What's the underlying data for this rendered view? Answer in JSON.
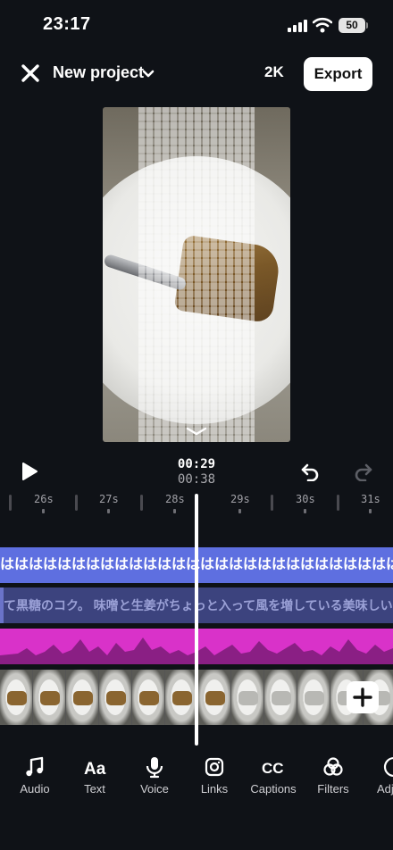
{
  "status": {
    "time": "23:17",
    "battery": "50"
  },
  "header": {
    "title": "New project",
    "resolution": "2K",
    "export_label": "Export"
  },
  "playback": {
    "current": "00:29",
    "total": "00:38"
  },
  "ruler": {
    "labels": [
      "26s",
      "27s",
      "28s",
      "29s",
      "30s",
      "31s"
    ]
  },
  "tracks": {
    "text": "はははははははははははははははははははははははははははははははは",
    "caption": "て黒糖のコク。 味噌と生姜がちょっと入って風を増している美味しいお持ちで"
  },
  "toolbar": {
    "items": [
      {
        "label": "Audio",
        "icon": "music-note-icon"
      },
      {
        "label": "Text",
        "icon": "text-aa-icon"
      },
      {
        "label": "Voice",
        "icon": "microphone-icon"
      },
      {
        "label": "Links",
        "icon": "instagram-icon"
      },
      {
        "label": "Captions",
        "icon": "cc-icon"
      },
      {
        "label": "Filters",
        "icon": "filters-icon"
      },
      {
        "label": "Adj",
        "icon": "adjust-icon"
      }
    ]
  },
  "colors": {
    "background": "#0f1217",
    "text_track": "#5e6fe0",
    "caption_track": "#3c437e",
    "audio_track": "#d932c9"
  }
}
